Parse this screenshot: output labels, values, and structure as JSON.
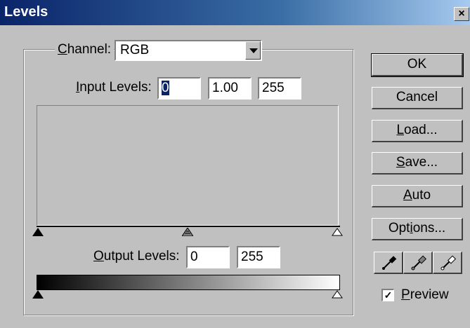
{
  "window": {
    "title": "Levels",
    "close_glyph": "×"
  },
  "channel": {
    "label_accel": "C",
    "label_rest": "hannel:",
    "value": "RGB"
  },
  "input_levels": {
    "label_accel": "I",
    "label_rest": "nput Levels:",
    "black": "0",
    "gamma": "1.00",
    "white": "255"
  },
  "output_levels": {
    "label_accel": "O",
    "label_rest": "utput Levels:",
    "black": "0",
    "white": "255"
  },
  "buttons": {
    "ok": "OK",
    "cancel": "Cancel",
    "load_accel": "L",
    "load_rest": "oad...",
    "save_accel": "S",
    "save_rest": "ave...",
    "auto_accel": "A",
    "auto_rest": "uto",
    "options_pre": "Opt",
    "options_accel": "i",
    "options_post": "ons..."
  },
  "eyedroppers": [
    "black-eyedropper-icon",
    "gray-eyedropper-icon",
    "white-eyedropper-icon"
  ],
  "preview": {
    "checked": true,
    "check_glyph": "✓",
    "label_accel": "P",
    "label_rest": "review"
  },
  "colors": {
    "title_bar": "#0a246a",
    "face": "#c0c0c0",
    "selection": "#0a246a"
  }
}
